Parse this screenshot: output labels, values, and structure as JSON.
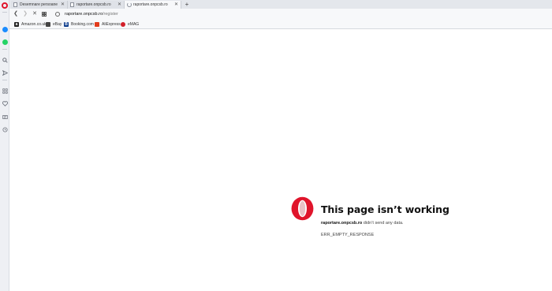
{
  "tabs": [
    {
      "title": "Desemnare persoane si no",
      "state": "inactive"
    },
    {
      "title": "raportare.onpcsb.ro",
      "state": "inactive"
    },
    {
      "title": "raportare.onpcsb.ro",
      "state": "active-loading"
    }
  ],
  "toolbar": {
    "url_host": "raportare.onpcsb.ro",
    "url_path": "/register"
  },
  "bookmarks": [
    {
      "label": "Amazon.co.uk",
      "icon": "amazon-icon",
      "color": "#222222"
    },
    {
      "label": "eBay",
      "icon": "ebay-icon",
      "color": "#444444"
    },
    {
      "label": "Booking.com",
      "icon": "booking-icon",
      "color": "#0b3b8c"
    },
    {
      "label": "AliExpress",
      "icon": "aliexpress-icon",
      "color": "#e23b1b"
    },
    {
      "label": "eMAG",
      "icon": "emag-icon",
      "color": "#d21f2a"
    }
  ],
  "sidebar": {
    "icons": [
      "opera-icon",
      "messenger-icon",
      "whatsapp-icon",
      "search-icon",
      "send-icon",
      "extensions-icon",
      "heart-icon",
      "news-icon",
      "history-icon"
    ]
  },
  "error": {
    "title": "This page isn’t working",
    "host": "raportare.onpcsb.ro",
    "message": "didn’t send any data.",
    "code": "ERR_EMPTY_RESPONSE"
  },
  "colors": {
    "brand_red": "#e0142b",
    "messenger": "#1a8cff",
    "whatsapp": "#25d366"
  }
}
